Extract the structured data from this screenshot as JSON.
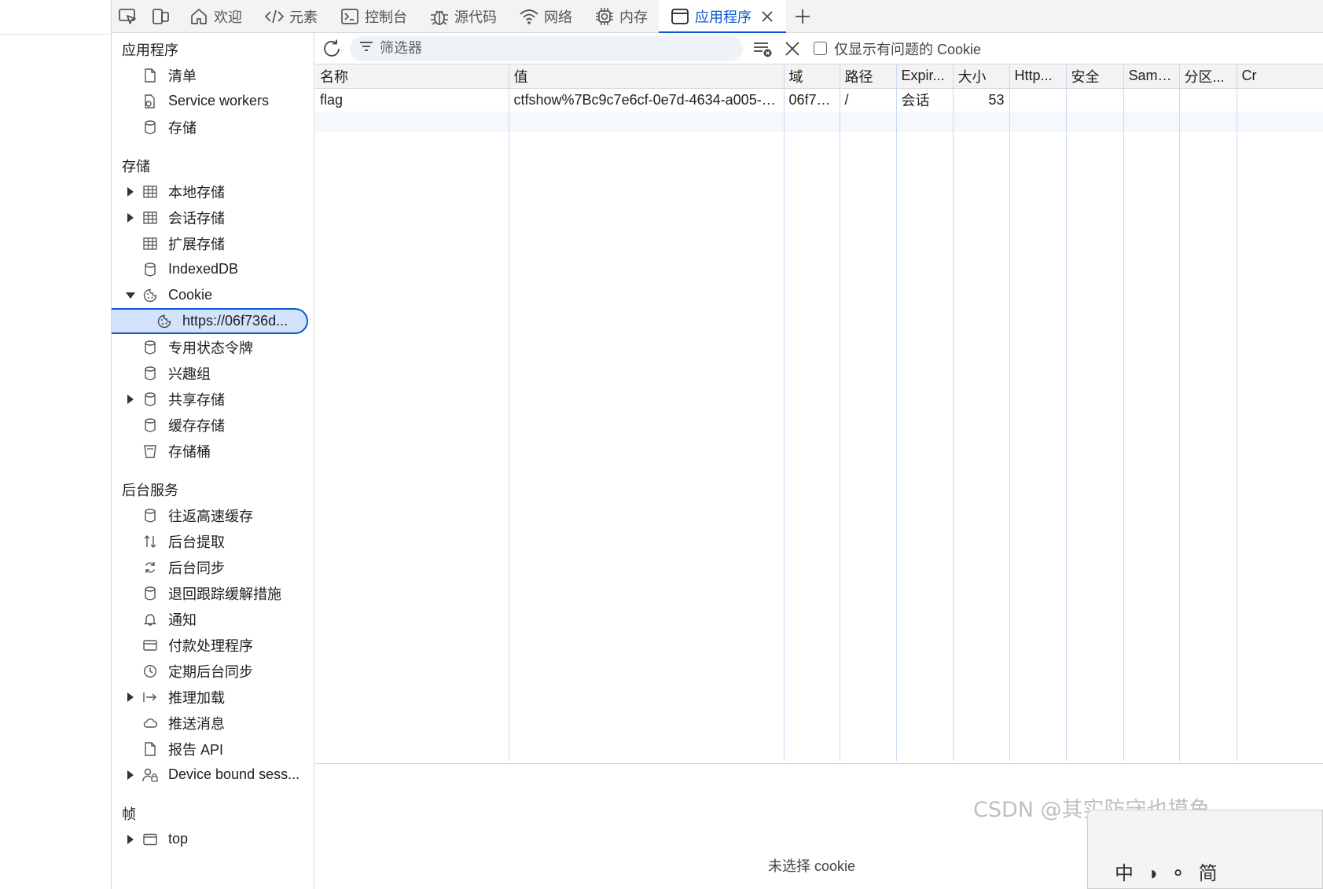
{
  "tabs": [
    {
      "label": "欢迎",
      "icon": "home-icon"
    },
    {
      "label": "元素",
      "icon": "code-icon"
    },
    {
      "label": "控制台",
      "icon": "console-icon"
    },
    {
      "label": "源代码",
      "icon": "bug-icon"
    },
    {
      "label": "网络",
      "icon": "wifi-icon"
    },
    {
      "label": "内存",
      "icon": "chip-icon"
    },
    {
      "label": "应用程序",
      "icon": "window-icon",
      "active": true
    }
  ],
  "sidebar": {
    "application": {
      "title": "应用程序",
      "items": [
        "清单",
        "Service workers",
        "存储"
      ]
    },
    "storage": {
      "title": "存储",
      "items": [
        "本地存储",
        "会话存储",
        "扩展存储",
        "IndexedDB",
        "Cookie",
        "https://06f736d...",
        "专用状态令牌",
        "兴趣组",
        "共享存储",
        "缓存存储",
        "存储桶"
      ]
    },
    "background": {
      "title": "后台服务",
      "items": [
        "往返高速缓存",
        "后台提取",
        "后台同步",
        "退回跟踪缓解措施",
        "通知",
        "付款处理程序",
        "定期后台同步",
        "推理加载",
        "推送消息",
        "报告 API",
        "Device bound sess..."
      ]
    },
    "frames": {
      "title": "帧",
      "items": [
        "top"
      ]
    }
  },
  "toolbar": {
    "filter_placeholder": "筛选器",
    "only_issues_label": "仅显示有问题的 Cookie"
  },
  "table": {
    "columns": [
      "名称",
      "值",
      "域",
      "路径",
      "Expir...",
      "大小",
      "Http...",
      "安全",
      "Same...",
      "分区...",
      "Cr"
    ],
    "rows": [
      [
        "flag",
        "ctfshow%7Bc9c7e6cf-0e7d-4634-a005-e...",
        "06f73...",
        "/",
        "会话",
        "53",
        "",
        "",
        "",
        "",
        ""
      ]
    ]
  },
  "bottom": {
    "hint": "未选择 cookie",
    "watermark": "CSDN @其实防守也摸鱼",
    "ime": [
      "中",
      "◑",
      "⚬",
      "简"
    ]
  },
  "colors": {
    "accent": "#0b57d0",
    "selected_bg": "#d3e3fd",
    "grid_line": "#c8daf2"
  }
}
